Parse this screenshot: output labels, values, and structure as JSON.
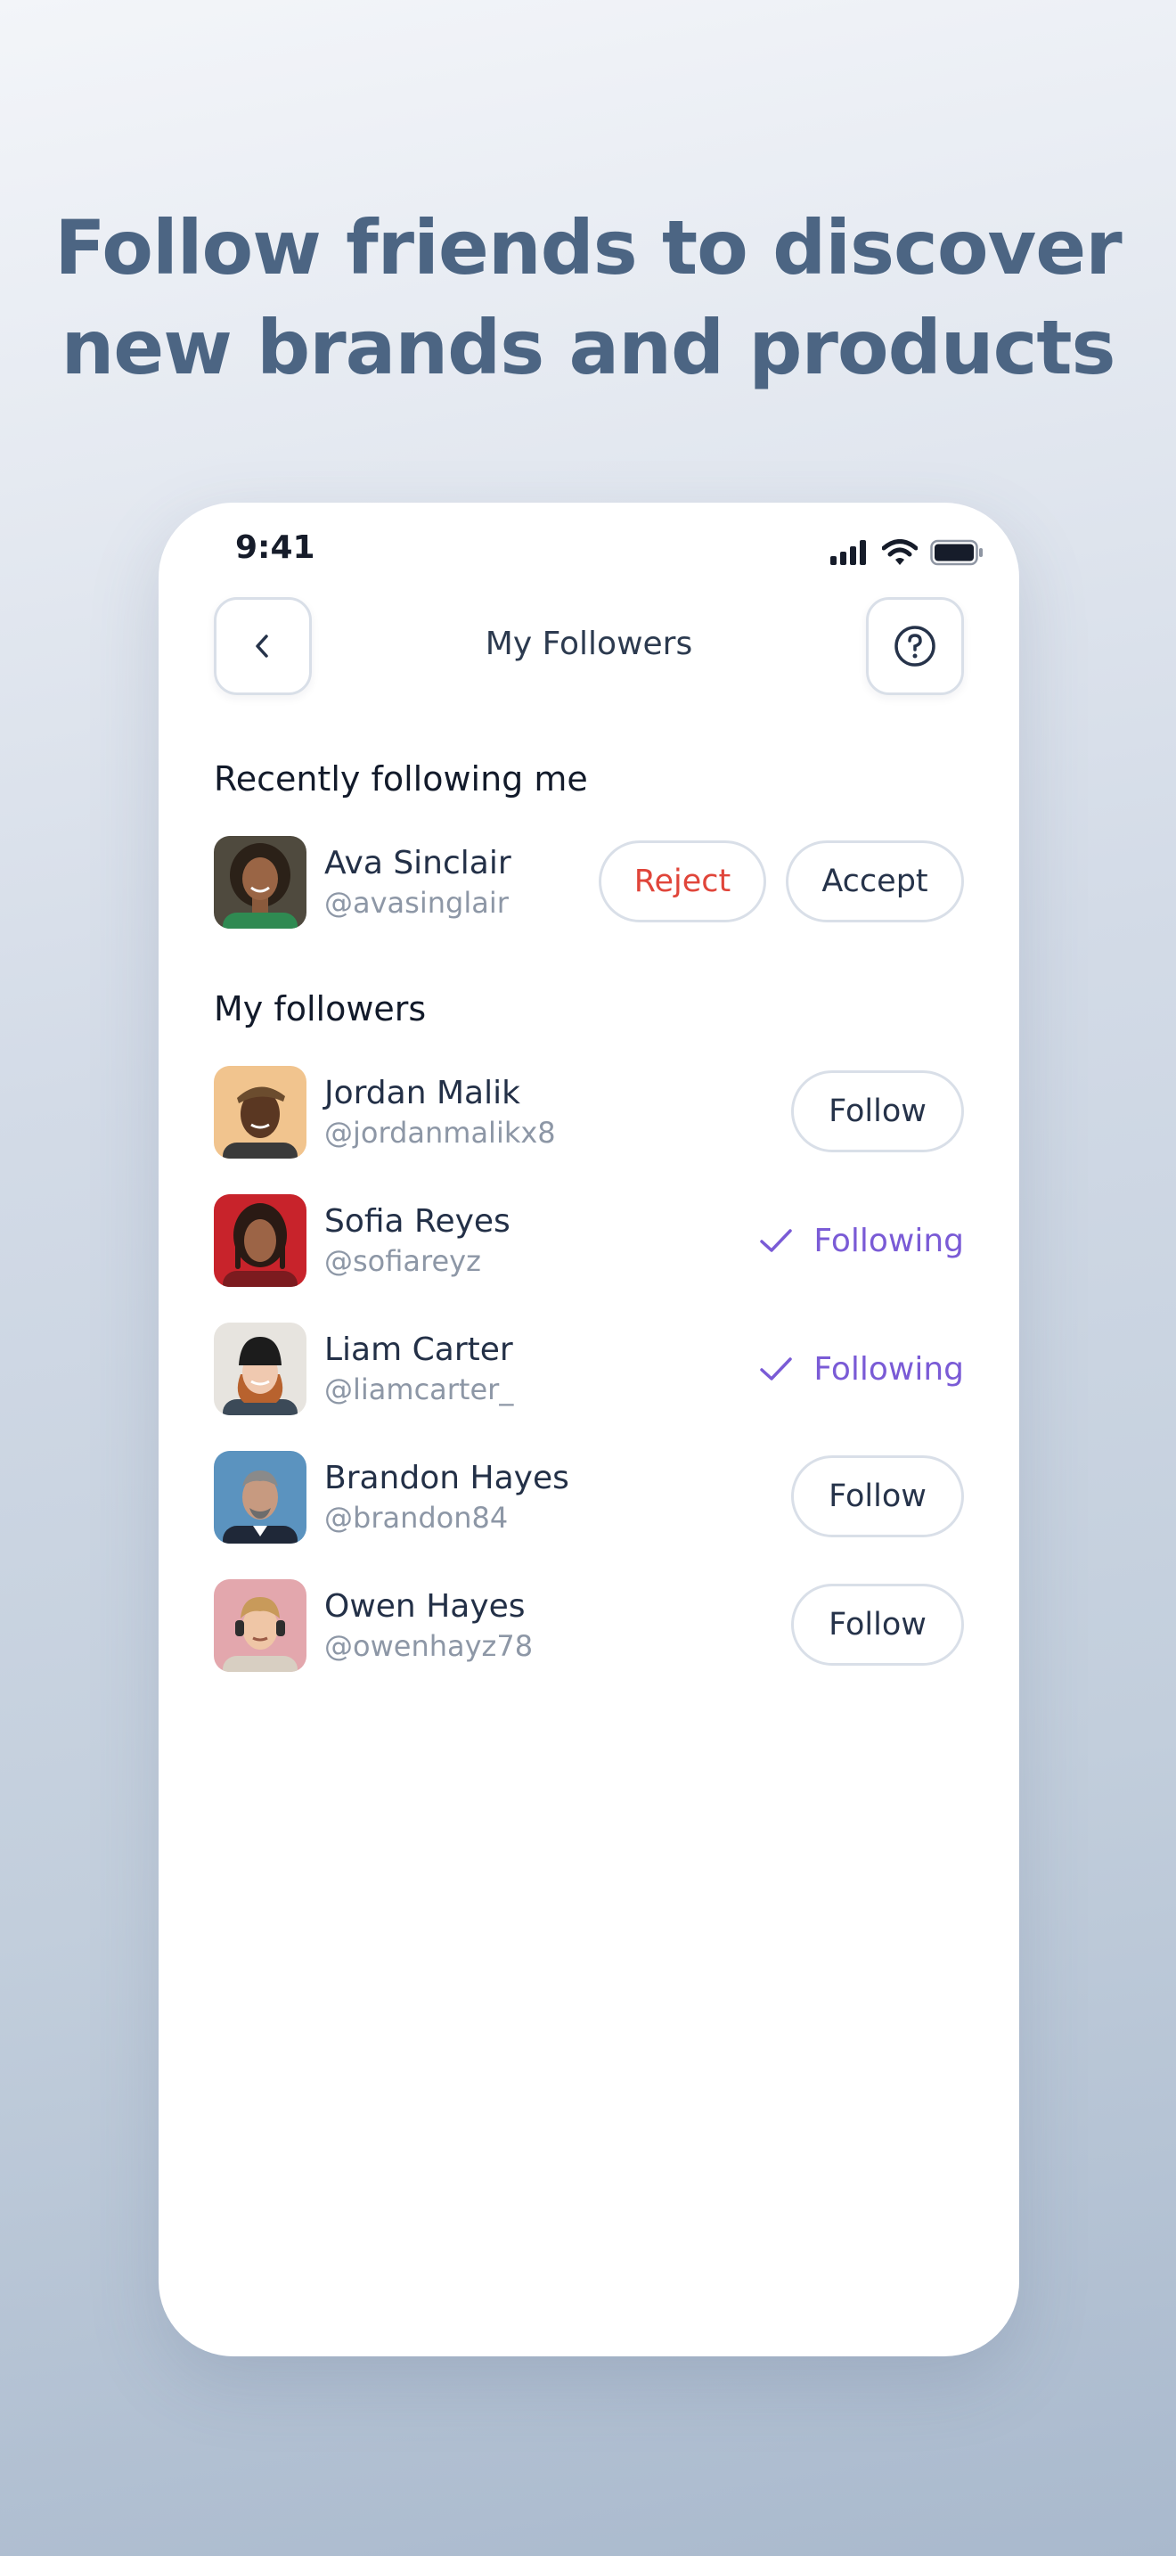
{
  "headline": {
    "line1": "Follow friends to discover",
    "line2": "new brands and products"
  },
  "status_bar": {
    "time": "9:41"
  },
  "nav": {
    "title": "My Followers",
    "back_icon": "chevron-left-icon",
    "help_icon": "question-circle-icon"
  },
  "requests": {
    "title": "Recently following me",
    "items": [
      {
        "name": "Ava Sinclair",
        "handle": "@avasinglair",
        "reject_label": "Reject",
        "accept_label": "Accept"
      }
    ]
  },
  "followers": {
    "title": "My followers",
    "items": [
      {
        "name": "Jordan Malik",
        "handle": "@jordanmalikx8",
        "action": "Follow"
      },
      {
        "name": "Sofia Reyes",
        "handle": "@sofiareyz",
        "action": "Following"
      },
      {
        "name": "Liam Carter",
        "handle": "@liamcarter_",
        "action": "Following"
      },
      {
        "name": "Brandon Hayes",
        "handle": "@brandon84",
        "action": "Follow"
      },
      {
        "name": "Owen Hayes",
        "handle": "@owenhayz78",
        "action": "Follow"
      }
    ]
  },
  "colors": {
    "headline": "#4c6583",
    "reject": "#e0453a",
    "following": "#7a5bd6",
    "border": "#d9dfe8"
  }
}
